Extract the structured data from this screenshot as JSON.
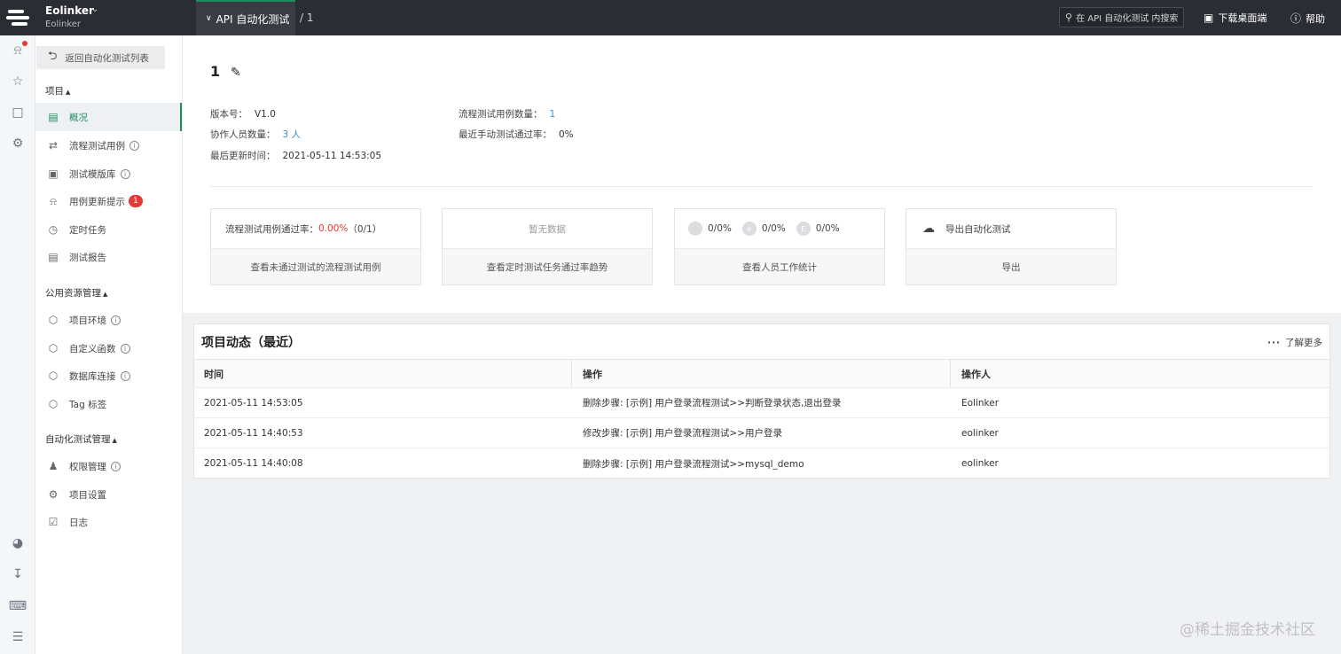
{
  "topbar": {
    "team_name": "Eolinker",
    "team_sub": "Eolinker",
    "project_tab": "API 自动化测试",
    "crumb": "/ 1",
    "search_placeholder": "在 API 自动化测试 内搜索",
    "download_label": "下载桌面端",
    "help_label": "帮助"
  },
  "sidebar": {
    "back_label": "返回自动化测试列表",
    "group_project": "项目",
    "items_project": [
      {
        "label": "概况"
      },
      {
        "label": "流程测试用例"
      },
      {
        "label": "测试模版库"
      },
      {
        "label": "用例更新提示",
        "badge": "1"
      },
      {
        "label": "定时任务"
      },
      {
        "label": "测试报告"
      }
    ],
    "group_resource": "公用资源管理",
    "items_resource": [
      {
        "label": "项目环境"
      },
      {
        "label": "自定义函数"
      },
      {
        "label": "数据库连接"
      },
      {
        "label": "Tag 标签"
      }
    ],
    "group_auto": "自动化测试管理",
    "items_auto": [
      {
        "label": "权限管理"
      },
      {
        "label": "项目设置"
      },
      {
        "label": "日志"
      }
    ]
  },
  "overview": {
    "title": "1",
    "version_label": "版本号：",
    "version_value": "V1.0",
    "members_label": "协作人员数量：",
    "members_value": "3 人",
    "updated_label": "最后更新时间：",
    "updated_value": "2021-05-11 14:53:05",
    "cases_label": "流程测试用例数量：",
    "cases_value": "1",
    "passrate_label": "最近手动测试通过率：",
    "passrate_value": "0%"
  },
  "cards": [
    {
      "top_label": "流程测试用例通过率：",
      "top_value": "0.00%",
      "top_extra": "（0/1）",
      "bottom": "查看未通过测试的流程测试用例"
    },
    {
      "top_label": "暂无数据",
      "bottom": "查看定时测试任务通过率趋势"
    },
    {
      "stats": [
        {
          "avatar": "",
          "value": "0/0%"
        },
        {
          "avatar": "e",
          "value": "0/0%"
        },
        {
          "avatar": "E",
          "value": "0/0%"
        }
      ],
      "bottom": "查看人员工作统计"
    },
    {
      "top_label": "导出自动化测试",
      "bottom": "导出"
    }
  ],
  "activity": {
    "title": "项目动态（最近）",
    "more_label": "了解更多",
    "columns": [
      "时间",
      "操作",
      "操作人"
    ],
    "rows": [
      {
        "time": "2021-05-11 14:53:05",
        "action": "删除步骤: [示例] 用户登录流程测试>>判断登录状态,退出登录",
        "operator": "Eolinker"
      },
      {
        "time": "2021-05-11 14:40:53",
        "action": "修改步骤: [示例] 用户登录流程测试>>用户登录",
        "operator": "eolinker"
      },
      {
        "time": "2021-05-11 14:40:08",
        "action": "删除步骤: [示例] 用户登录流程测试>>mysql_demo",
        "operator": "eolinker"
      }
    ]
  },
  "watermark": "@稀土掘金技术社区"
}
